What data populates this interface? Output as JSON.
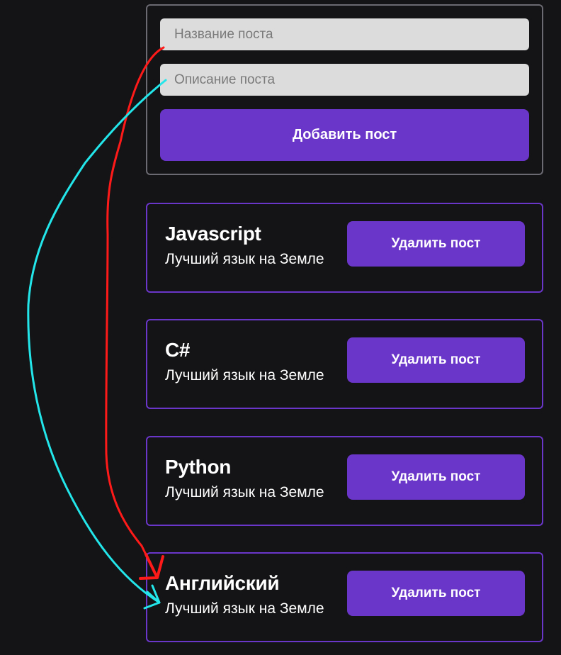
{
  "form": {
    "title_placeholder": "Название поста",
    "description_placeholder": "Описание поста",
    "add_button_label": "Добавить пост"
  },
  "posts": [
    {
      "title": "Javascript",
      "description": "Лучший язык на Земле",
      "delete_label": "Удалить пост"
    },
    {
      "title": "C#",
      "description": "Лучший язык на Земле",
      "delete_label": "Удалить пост"
    },
    {
      "title": "Python",
      "description": "Лучший язык на Земле",
      "delete_label": "Удалить пост"
    },
    {
      "title": "Английский",
      "description": "Лучший язык на Земле",
      "delete_label": "Удалить пост"
    }
  ],
  "colors": {
    "background": "#141416",
    "accent": "#6a35c9",
    "input_bg": "#dcdcdc",
    "annotation_red": "#ff1a1a",
    "annotation_cyan": "#22e6ea"
  }
}
